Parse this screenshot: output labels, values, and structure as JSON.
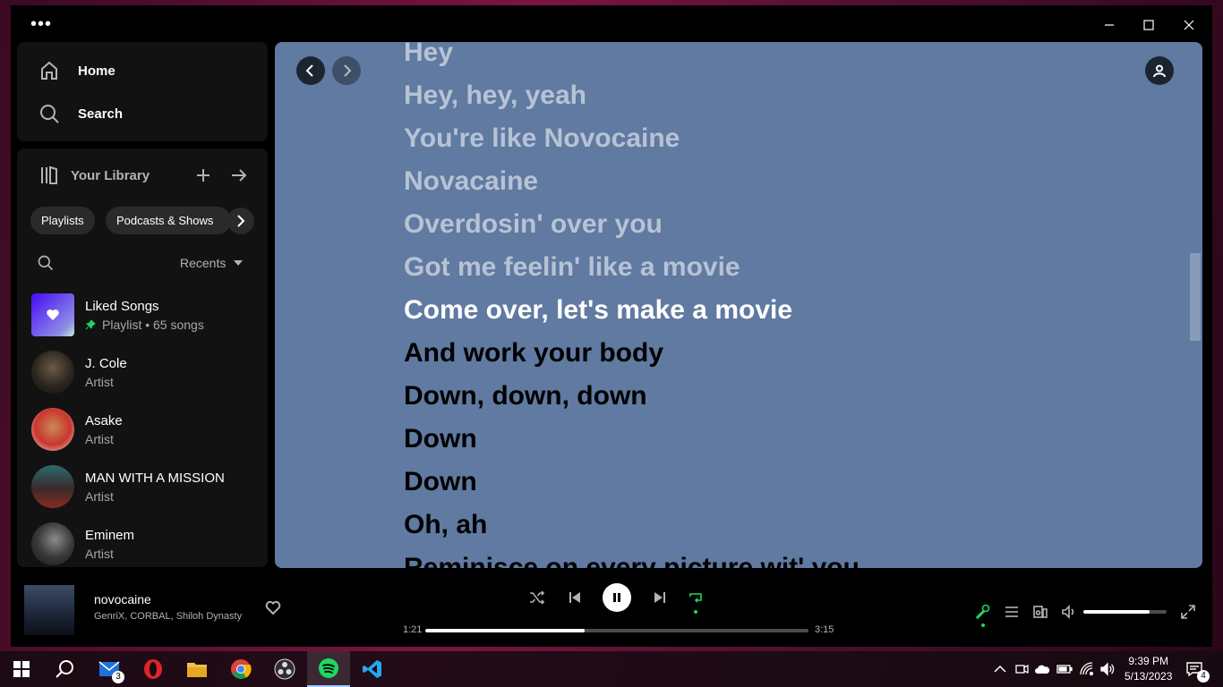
{
  "nav": {
    "home": "Home",
    "search": "Search"
  },
  "library": {
    "title": "Your Library",
    "chips": [
      "Playlists",
      "Podcasts & Shows"
    ],
    "sort_label": "Recents",
    "items": [
      {
        "title": "Liked Songs",
        "subtitle": "Playlist • 65 songs"
      },
      {
        "title": "J. Cole",
        "subtitle": "Artist"
      },
      {
        "title": "Asake",
        "subtitle": "Artist"
      },
      {
        "title": "MAN WITH A MISSION",
        "subtitle": "Artist"
      },
      {
        "title": "Eminem",
        "subtitle": "Artist"
      }
    ]
  },
  "lyrics": {
    "past": [
      "Hey",
      "Hey, hey, yeah",
      "You're like Novocaine",
      "Novacaine",
      "Overdosin' over you",
      "Got me feelin' like a movie"
    ],
    "current": "Come over, let's make a movie",
    "future": [
      "And work your body",
      "Down, down, down",
      "Down",
      "Down",
      "Oh, ah",
      "Reminisce on every picture wit' you"
    ]
  },
  "now_playing": {
    "title": "novocaine",
    "artist": "GenriX, CORBAL, Shiloh Dynasty",
    "elapsed": "1:21",
    "duration": "3:15",
    "progress": 0.415,
    "volume": 0.8
  },
  "taskbar": {
    "mail_badge": "3",
    "notification_badge": "4",
    "time": "9:39 PM",
    "date": "5/13/2023"
  },
  "colors": {
    "lyrics_bg": "#607aa1",
    "accent_green": "#1ed760"
  }
}
